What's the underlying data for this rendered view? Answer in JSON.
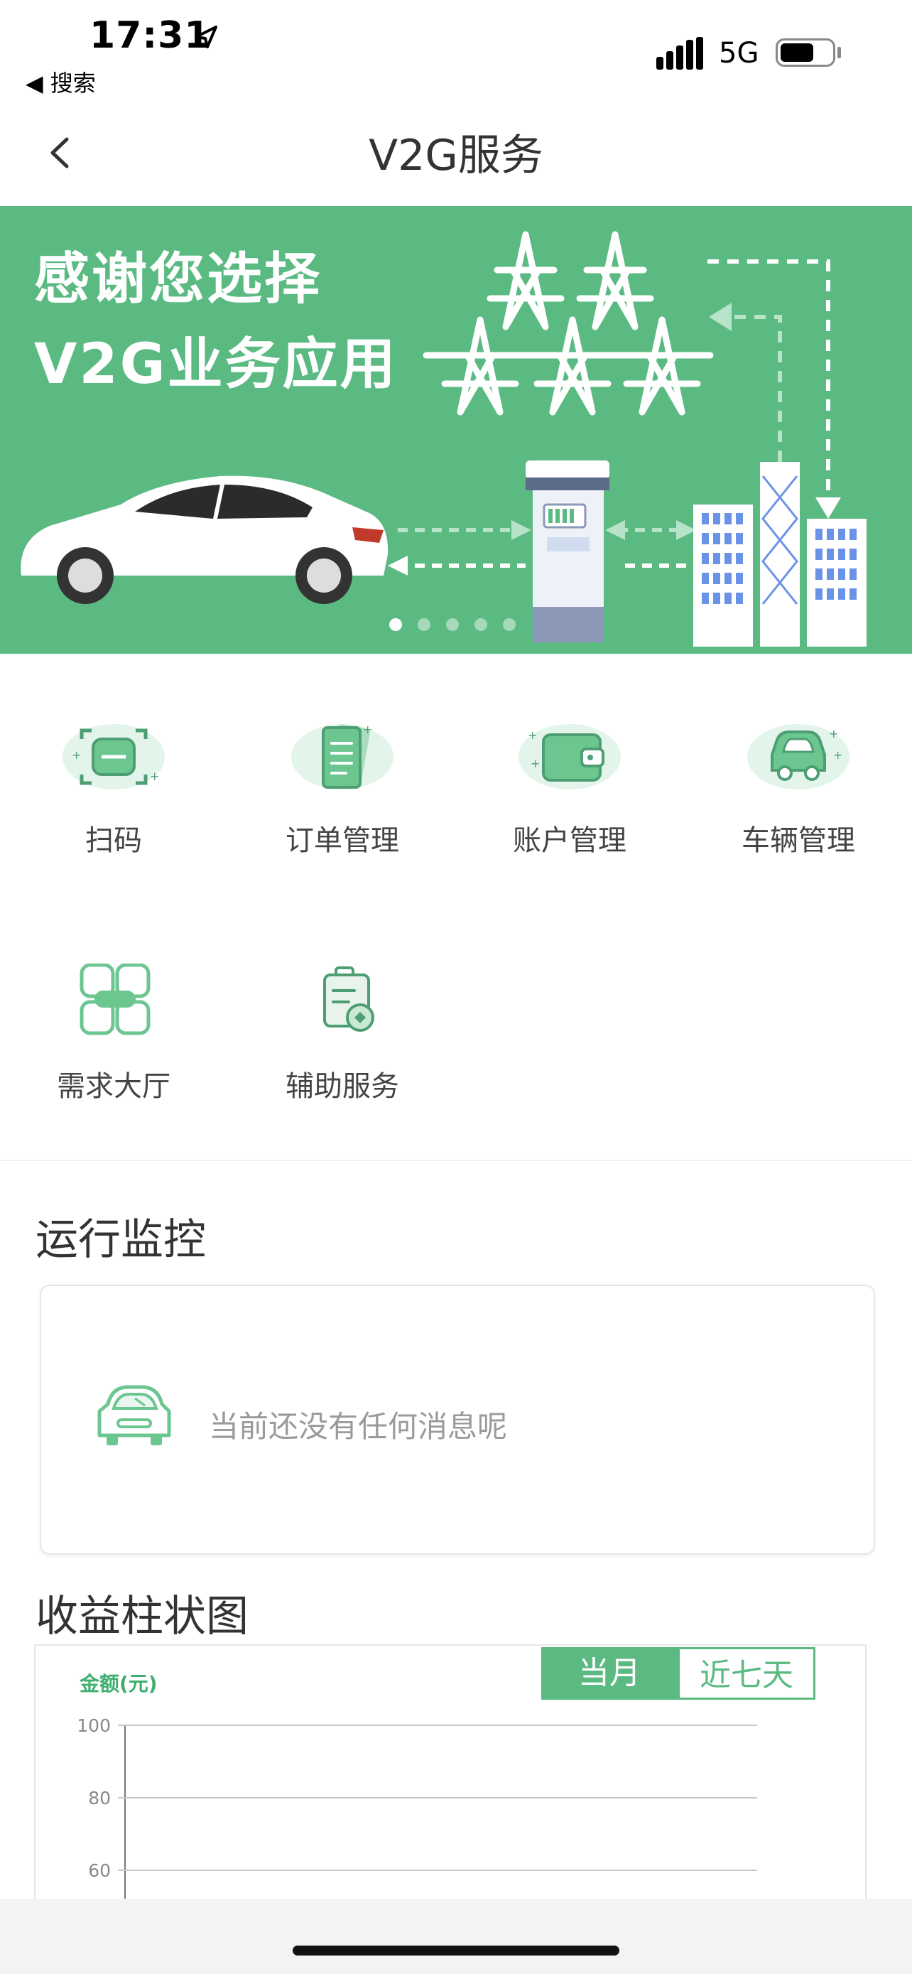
{
  "status_bar": {
    "time": "17:31",
    "back_app": "◀ 搜索",
    "network": "5G"
  },
  "nav": {
    "title": "V2G服务"
  },
  "banner": {
    "line1": "感谢您选择",
    "line2": "V2G业务应用",
    "slide_count": 5,
    "active_slide": 1
  },
  "menu": {
    "items": [
      {
        "label": "扫码",
        "icon": "scan-icon"
      },
      {
        "label": "订单管理",
        "icon": "order-icon"
      },
      {
        "label": "账户管理",
        "icon": "wallet-icon"
      },
      {
        "label": "车辆管理",
        "icon": "car-icon"
      },
      {
        "label": "需求大厅",
        "icon": "demand-hall-icon"
      },
      {
        "label": "辅助服务",
        "icon": "assist-service-icon"
      }
    ]
  },
  "monitor": {
    "title": "运行监控",
    "empty_text": "当前还没有任何消息呢"
  },
  "revenue": {
    "title": "收益柱状图",
    "tabs": [
      "当月",
      "近七天"
    ],
    "active_tab": "当月"
  },
  "chart_data": {
    "type": "bar",
    "ylabel": "金额(元)",
    "ylim": [
      0,
      100
    ],
    "yticks": [
      "100",
      "80",
      "60"
    ],
    "categories": [],
    "values": [],
    "grid": true
  },
  "colors": {
    "accent": "#5bba82",
    "text": "#333333"
  }
}
